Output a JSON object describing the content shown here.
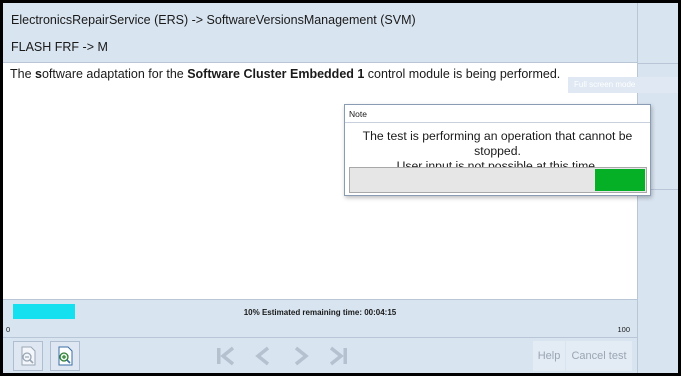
{
  "header": {
    "line1": "ElectronicsRepairService (ERS) -> SoftwareVersionsManagement (SVM)",
    "line2": "FLASH FRF -> M"
  },
  "message": {
    "part1": "The ",
    "part2": "s",
    "part3": "oftware adaptation for the ",
    "part4": "Software Cluster Embedded 1",
    "part5": " control module is being performed."
  },
  "side_panel": {
    "ghost_label": "Full screen mode"
  },
  "note": {
    "title": "Note",
    "line1": "The test is performing an operation that cannot be stopped.",
    "line2": "User input is not possible at this time.",
    "progress_fraction": 0.17
  },
  "progress": {
    "status": "10% Estimated remaining time: 00:04:15",
    "min": "0",
    "max": "100",
    "percent": 10
  },
  "toolbar": {
    "zoom_out_icon": "zoom-out-icon",
    "zoom_in_icon": "zoom-in-icon",
    "first_icon": "skip-first-icon",
    "prev_icon": "chevron-left-icon",
    "next_icon": "chevron-right-icon",
    "last_icon": "skip-last-icon",
    "help_label": "Help",
    "cancel_label": "Cancel test"
  },
  "colors": {
    "panel": "#d8e4f0",
    "progress_cyan": "#14e0f0",
    "note_progress_green": "#06b026",
    "disabled_text": "#9aa6b4"
  }
}
